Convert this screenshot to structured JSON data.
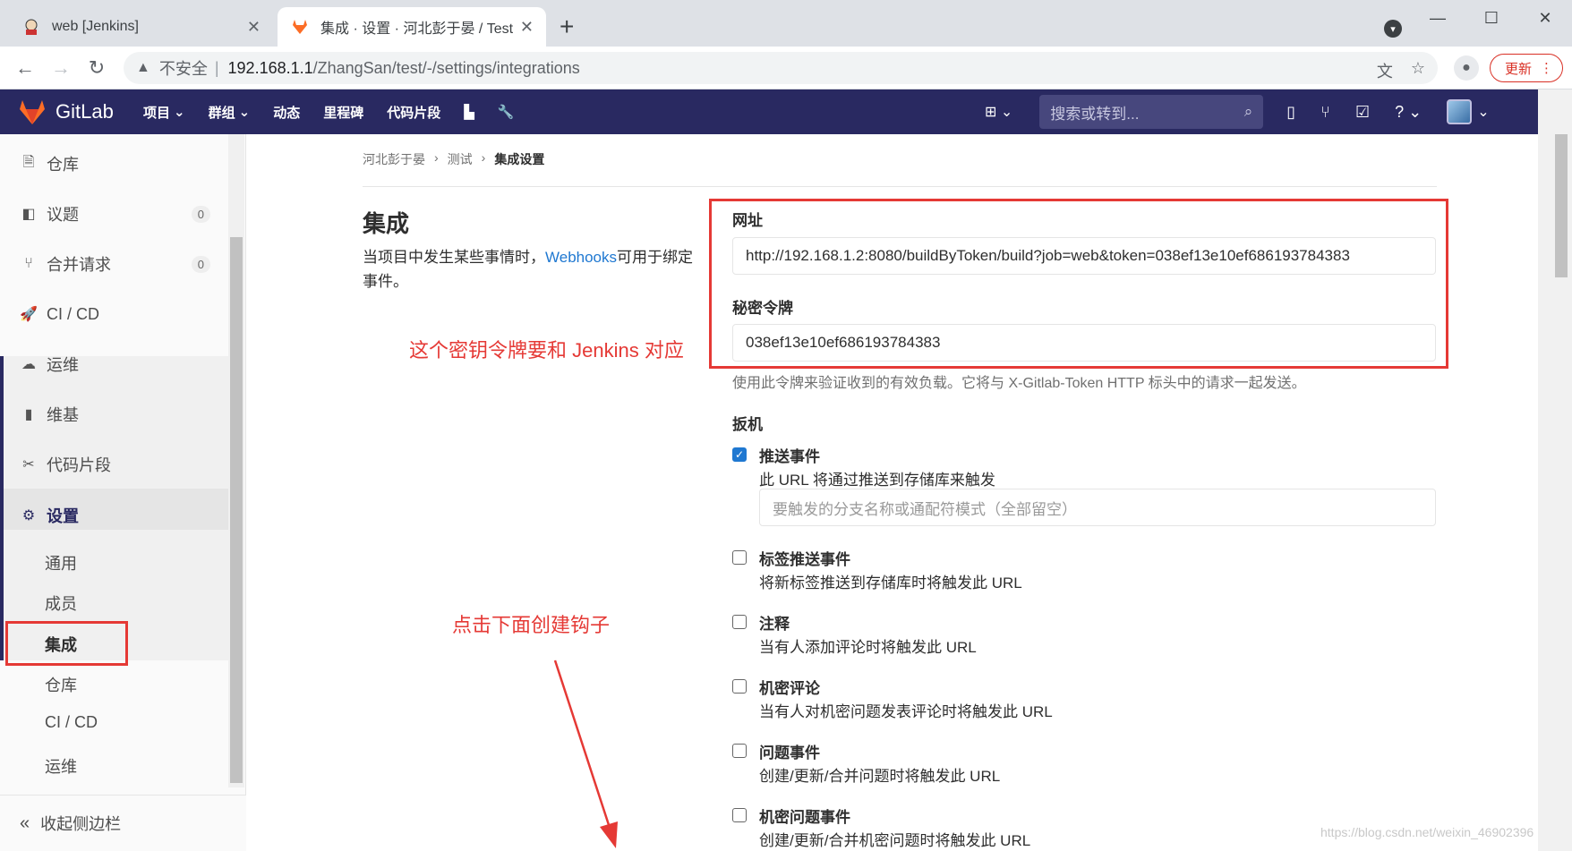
{
  "browser": {
    "tabs": [
      {
        "title": "web [Jenkins]",
        "active": false
      },
      {
        "title": "集成 · 设置 · 河北彭于晏 / Test ·",
        "active": true
      }
    ],
    "insecure_label": "不安全",
    "separator": "|",
    "url_host": "192.168.1.1",
    "url_path": "/ZhangSan/test/-/settings/integrations",
    "update_label": "更新"
  },
  "gitlab": {
    "brand": "GitLab",
    "nav": [
      "项目",
      "群组",
      "动态",
      "里程碑",
      "代码片段"
    ],
    "search_placeholder": "搜索或转到..."
  },
  "sidebar": {
    "items": [
      {
        "label": "仓库",
        "icon": "document-icon"
      },
      {
        "label": "议题",
        "icon": "issues-icon",
        "count": "0"
      },
      {
        "label": "合并请求",
        "icon": "merge-request-icon",
        "count": "0"
      },
      {
        "label": "CI / CD",
        "icon": "rocket-icon"
      },
      {
        "label": "运维",
        "icon": "cloud-gear-icon"
      },
      {
        "label": "维基",
        "icon": "book-icon"
      },
      {
        "label": "代码片段",
        "icon": "scissors-icon"
      },
      {
        "label": "设置",
        "icon": "gear-icon"
      }
    ],
    "settings_sub": [
      "通用",
      "成员",
      "集成",
      "仓库",
      "CI / CD",
      "运维"
    ],
    "active_sub": "集成",
    "collapse_label": "收起侧边栏"
  },
  "breadcrumb": [
    "河北彭于晏",
    "测试",
    "集成设置"
  ],
  "page": {
    "title": "集成",
    "desc_before": "当项目中发生某些事情时，",
    "desc_link": "Webhooks",
    "desc_after": "可用于绑定事件。"
  },
  "form": {
    "url_label": "网址",
    "url_value": "http://192.168.1.2:8080/buildByToken/build?job=web&token=038ef13e10ef686193784383",
    "token_label": "秘密令牌",
    "token_value": "038ef13e10ef686193784383",
    "token_help": "使用此令牌来验证收到的有效负载。它将与 X-Gitlab-Token HTTP 标头中的请求一起发送。",
    "triggers_title": "扳机",
    "branch_placeholder": "要触发的分支名称或通配符模式（全部留空）",
    "triggers": [
      {
        "name": "推送事件",
        "desc": "此 URL 将通过推送到存储库来触发",
        "checked": true
      },
      {
        "name": "标签推送事件",
        "desc": "将新标签推送到存储库时将触发此 URL",
        "checked": false
      },
      {
        "name": "注释",
        "desc": "当有人添加评论时将触发此 URL",
        "checked": false
      },
      {
        "name": "机密评论",
        "desc": "当有人对机密问题发表评论时将触发此 URL",
        "checked": false
      },
      {
        "name": "问题事件",
        "desc": "创建/更新/合并问题时将触发此 URL",
        "checked": false
      },
      {
        "name": "机密问题事件",
        "desc": "创建/更新/合并机密问题时将触发此 URL",
        "checked": false
      }
    ]
  },
  "annotations": {
    "token_note": "这个密钥令牌要和 Jenkins 对应",
    "click_note": "点击下面创建钩子",
    "color": "#e53935"
  },
  "watermark": "https://blog.csdn.net/weixin_46902396"
}
